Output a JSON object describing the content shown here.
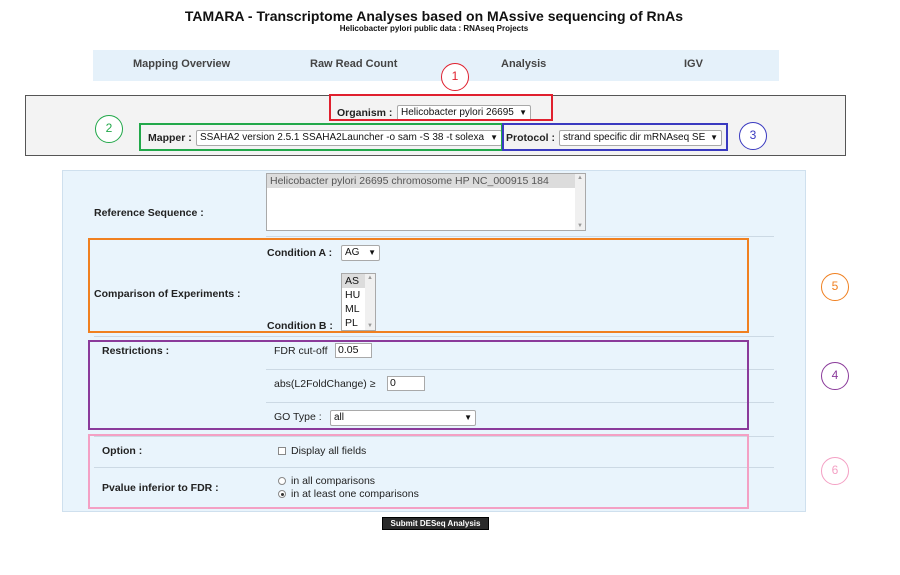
{
  "header": {
    "title": "TAMARA - Transcriptome Analyses based on MAssive sequencing of RnAs",
    "subtitle": "Helicobacter pylori public data : RNAseq Projects"
  },
  "nav": {
    "items": [
      "Mapping Overview",
      "Raw Read Count",
      "Analysis",
      "IGV"
    ]
  },
  "params": {
    "organism_label": "Organism :",
    "organism_value": "Helicobacter pylori 26695",
    "mapper_label": "Mapper :",
    "mapper_value": "SSAHA2 version 2.5.1 SSAHA2Launcher -o sam -S 38 -t solexa",
    "protocol_label": "Protocol :",
    "protocol_value": "strand specific dir mRNAseq SE"
  },
  "form": {
    "reference_label": "Reference Sequence :",
    "reference_value": "Helicobacter pylori 26695 chromosome HP NC_000915 184",
    "comparison_label": "Comparison of Experiments :",
    "condition_a_label": "Condition A :",
    "condition_a_value": "AG",
    "condition_b_label": "Condition B :",
    "condition_b_options": [
      "AS",
      "HU",
      "ML",
      "PL"
    ],
    "restrictions_label": "Restrictions :",
    "fdr_label": "FDR cut-off",
    "fdr_value": "0.05",
    "l2fc_label": "abs(L2FoldChange) ≥",
    "l2fc_value": "0",
    "go_label": "GO Type :",
    "go_value": "all",
    "option_label": "Option :",
    "display_all_label": "Display all fields",
    "pvalue_label": "Pvalue inferior to FDR :",
    "radio_all": "in all comparisons",
    "radio_one": "in at least one comparisons",
    "submit_label": "Submit DESeq Analysis"
  },
  "annotations": {
    "markers": [
      "1",
      "2",
      "3",
      "4",
      "5",
      "6"
    ],
    "colors": {
      "1": "#e0202e",
      "2": "#22a84a",
      "3": "#3a3ac0",
      "4": "#8a3a9a",
      "5": "#f08020",
      "6": "#f4a0c4"
    }
  }
}
